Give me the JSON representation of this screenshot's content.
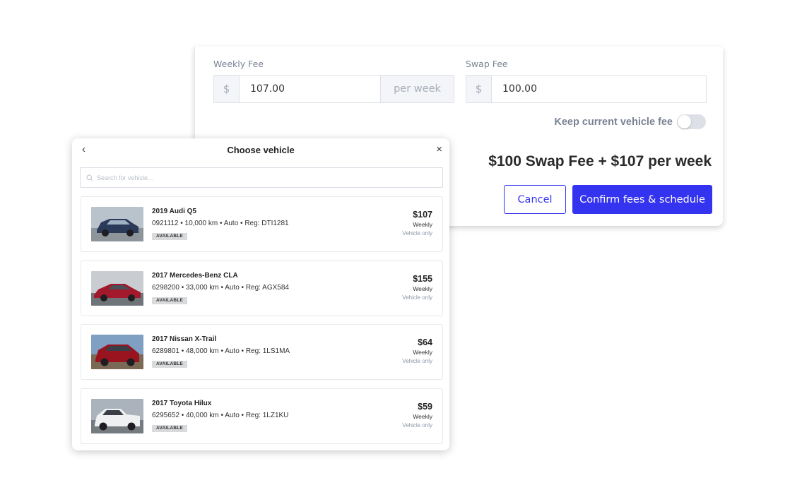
{
  "fees": {
    "weekly_fee_label": "Weekly Fee",
    "weekly_fee_prefix": "$",
    "weekly_fee_value": "107.00",
    "weekly_fee_suffix": "per week",
    "swap_fee_label": "Swap Fee",
    "swap_fee_prefix": "$",
    "swap_fee_value": "100.00",
    "keep_current_label": "Keep current vehicle fee",
    "keep_current_on": false,
    "summary": "$100 Swap Fee + $107 per week",
    "cancel_label": "Cancel",
    "confirm_label": "Confirm fees & schedule",
    "accent_color": "#3434f0"
  },
  "modal": {
    "back_glyph": "‹",
    "title": "Choose vehicle",
    "close_glyph": "×",
    "search_placeholder": "Search for vehicle...",
    "vehicles": [
      {
        "name": "2019 Audi Q5",
        "meta": "0921112 • 10,000 km • Auto • Reg: DTI1281",
        "status": "AVAILABLE",
        "price": "$107",
        "period": "Weekly",
        "note": "Vehicle only",
        "car_color": "#2c3a5a"
      },
      {
        "name": "2017 Mercedes-Benz CLA",
        "meta": "6298200 • 33,000 km • Auto • Reg: AGX584",
        "status": "AVAILABLE",
        "price": "$155",
        "period": "Weekly",
        "note": "Vehicle only",
        "car_color": "#a3182a"
      },
      {
        "name": "2017 Nissan X-Trail",
        "meta": "6289801 • 48,000 km • Auto • Reg: 1LS1MA",
        "status": "AVAILABLE",
        "price": "$64",
        "period": "Weekly",
        "note": "Vehicle only",
        "car_color": "#9a1420"
      },
      {
        "name": "2017 Toyota Hilux",
        "meta": "6295652 • 40,000 km • Auto • Reg: 1LZ1KU",
        "status": "AVAILABLE",
        "price": "$59",
        "period": "Weekly",
        "note": "Vehicle only",
        "car_color": "#eef0f2"
      }
    ]
  }
}
